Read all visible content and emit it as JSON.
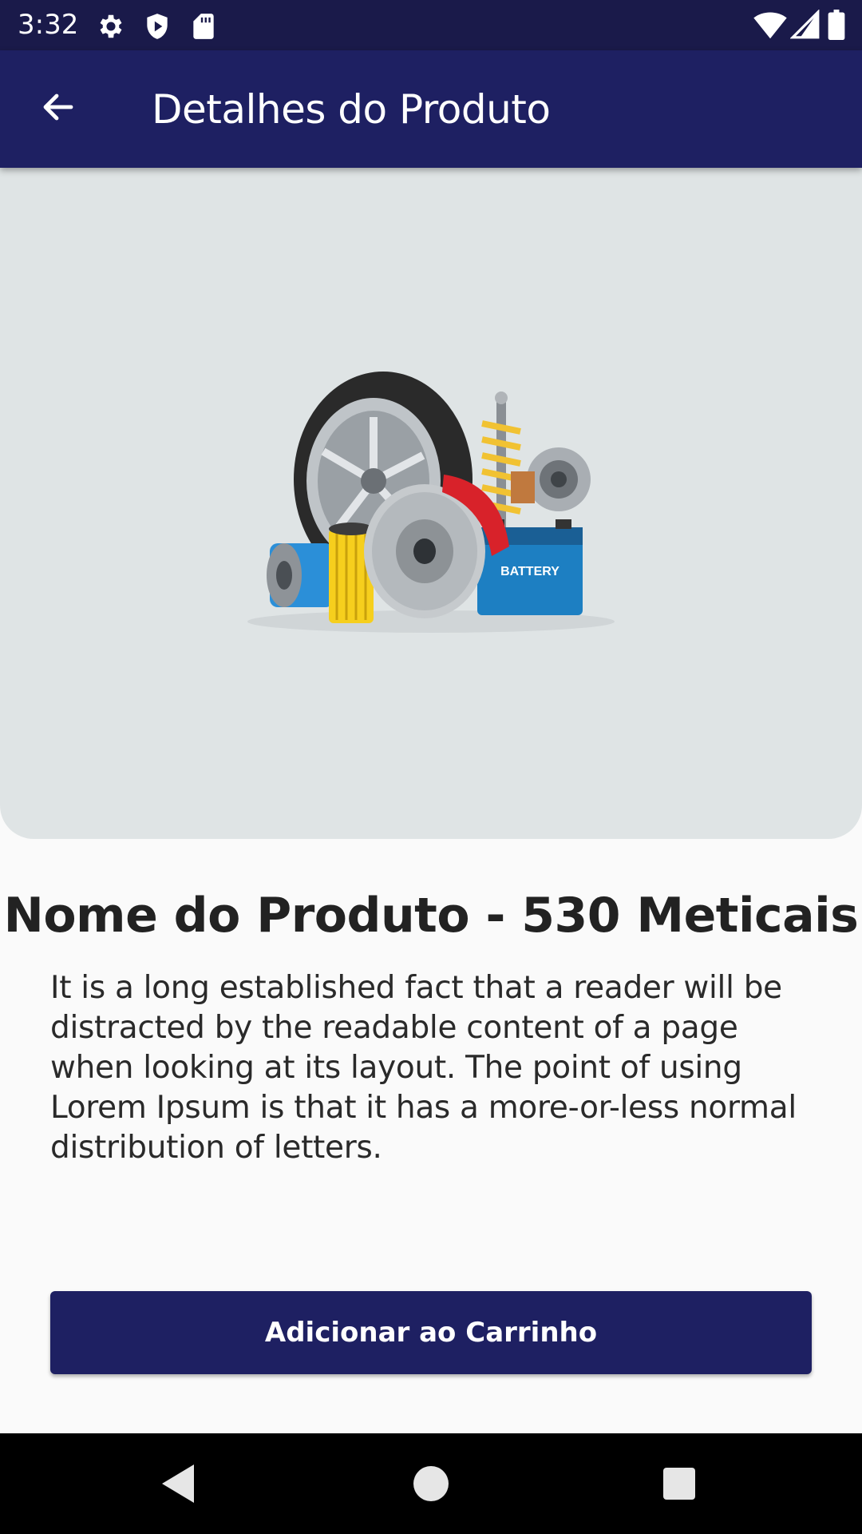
{
  "status_bar": {
    "time": "3:32",
    "icons": [
      "settings-icon",
      "shield-play-icon",
      "sd-card-icon",
      "wifi-icon",
      "signal-icon",
      "battery-icon"
    ]
  },
  "app_bar": {
    "title": "Detalhes do Produto",
    "back_icon": "arrow-back-icon"
  },
  "product": {
    "image_label": "BATTERY",
    "title": "Nome do Produto - 530 Meticais",
    "description": "It is a long established fact that a reader will be distracted by the readable content of a page when looking at its layout. The point of using Lorem Ipsum is that it has a more-or-less normal distribution of letters."
  },
  "actions": {
    "add_to_cart": "Adicionar ao Carrinho"
  },
  "nav_bar": {
    "icons": [
      "back-triangle-icon",
      "home-circle-icon",
      "recents-square-icon"
    ]
  },
  "colors": {
    "primary": "#1e2062",
    "status_bar": "#1a1a4a",
    "image_bg": "#dfe4e5",
    "page_bg": "#fafafa"
  }
}
